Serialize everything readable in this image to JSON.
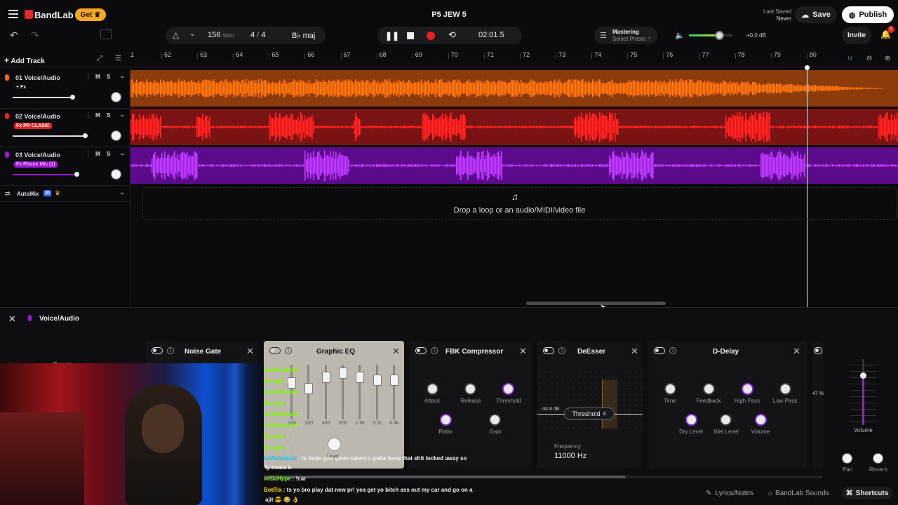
{
  "header": {
    "project_title": "P5 JEW 5",
    "get_label": "Get",
    "brand": "BandLab",
    "last_saved_label": "Last Saved",
    "last_saved_value": "Never",
    "save_label": "Save",
    "publish_label": "Publish",
    "invite_label": "Invite",
    "notification_count": "1"
  },
  "transport": {
    "bpm_value": "156",
    "bpm_unit": "bpm",
    "time_sig_num": "4",
    "time_sig_sep": "/",
    "time_sig_den": "4",
    "key": "B♭ maj",
    "time": "02:01.5"
  },
  "mastering": {
    "label": "Mastering",
    "preset": "Select Preset",
    "level": "+0.0 dB",
    "volume_fraction": 0.7
  },
  "tracks_toolbar": {
    "add_track_label": "Add Track"
  },
  "tracks": [
    {
      "name": "01  Voice/Audio",
      "fx": "+ Fx",
      "m": "M",
      "s": "S",
      "color": "#ff6a00",
      "volume_fraction": 0.62
    },
    {
      "name": "02  Voice/Audio",
      "fx": "Fx  PR CLASIC",
      "m": "M",
      "s": "S",
      "color": "#e8201e",
      "volume_fraction": 0.77
    },
    {
      "name": "03  Voice/Audio",
      "fx": "Fx  Phone Mix (1)",
      "m": "M",
      "s": "S",
      "color": "#9b18d8",
      "volume_fraction": 0.68
    }
  ],
  "automix": {
    "label": "AutoMix",
    "badge": "AI"
  },
  "ruler": {
    "first": "1",
    "numbers": [
      "62",
      "63",
      "64",
      "65",
      "66",
      "67",
      "68",
      "69",
      "70",
      "71",
      "72",
      "73",
      "74",
      "75",
      "76",
      "77",
      "78",
      "79",
      "80"
    ]
  },
  "dropzone": {
    "text": "Drop a loop or an audio/MIDI/video file"
  },
  "fx_panel": {
    "track_label": "Voice/Audio",
    "presets_label": "Presets",
    "plugins": {
      "noise_gate": "Noise Gate",
      "graphic_eq": "Graphic EQ",
      "fbk_compressor": "FBK Compressor",
      "deesser": "DeEsser",
      "d_delay": "D-Delay"
    },
    "eq_bands": [
      "100",
      "200",
      "400",
      "800",
      "1.6k",
      "3.2k",
      "6.4k"
    ],
    "eq_level_label": "Level",
    "compressor": {
      "attack": "Attack",
      "release": "Release",
      "threshold": "Threshold",
      "ratio": "Ratio",
      "gain": "Gain"
    },
    "deesser": {
      "db": "-34.8 dB",
      "threshold_btn": "Threshold",
      "frequency_label": "Frequency",
      "frequency_value": "11000 Hz"
    },
    "delay": {
      "time": "Time",
      "feedback": "Feedback",
      "high_pass": "High Pass",
      "low_pass": "Low Pass",
      "dry": "Dry Level",
      "wet": "Wet Level",
      "volume": "Volume"
    },
    "partial_pct": "47 %",
    "master": {
      "volume": "Volume",
      "pan": "Pan",
      "reverb": "Reverb"
    }
  },
  "chat": [
    {
      "user": "Karlwithabbc",
      "msg": ""
    },
    {
      "user": "Resukio",
      "msg": ":"
    },
    {
      "user": "Karlwithabbc",
      "msg": ""
    },
    {
      "user": "Resukio",
      "msg": ":"
    },
    {
      "user": "Karlwithabbc",
      "msg": ":"
    },
    {
      "user": "Karlwithabbc",
      "msg": ":"
    },
    {
      "user": "Resukio",
      "msg": ":"
    },
    {
      "user": "Resukio",
      "msg": ":"
    },
    {
      "user": "keWazowski",
      "msg": ": ts thats god given talent u gotta keep that shit locked away so"
    },
    {
      "user": "",
      "msg": "ly hears it"
    },
    {
      "user": "veDaHype",
      "msg": ": !car"
    },
    {
      "user": "BotRix",
      "msg": ": ts yo bro play dat new pr! yea get yo bitch ass out my car and go on a"
    },
    {
      "user": "",
      "msg": "ajit 😎 😂 👌"
    }
  ],
  "footer": {
    "lyrics": "Lyrics/Notes",
    "sounds": "BandLab Sounds",
    "shortcuts": "Shortcuts"
  },
  "colors": {
    "orange": "#ff6a00",
    "red": "#e8201e",
    "purple": "#9b18d8",
    "accent": "#f5a623"
  }
}
